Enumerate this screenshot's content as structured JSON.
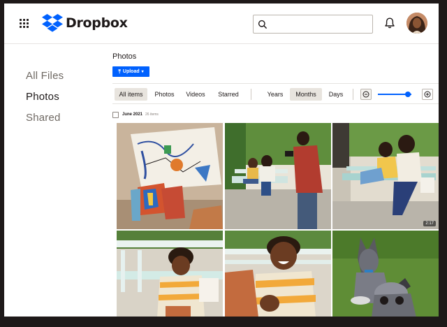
{
  "app": {
    "logo_text": "Dropbox"
  },
  "search": {
    "value": "",
    "placeholder": ""
  },
  "sidebar": {
    "items": [
      {
        "label": "All Files",
        "active": false
      },
      {
        "label": "Photos",
        "active": true
      },
      {
        "label": "Shared",
        "active": false
      }
    ]
  },
  "main": {
    "title": "Photos",
    "upload_label": "Upload"
  },
  "toolbar": {
    "filters": [
      "All items",
      "Photos",
      "Videos",
      "Starred"
    ],
    "selected_filter": "All items",
    "views": [
      "Years",
      "Months",
      "Days"
    ],
    "selected_view": "Months",
    "zoom_level": 0.9
  },
  "gallery": {
    "date_label": "June 2021",
    "count_label": "26 items",
    "photos": [
      {
        "subject": "abstract collage artwork",
        "duration": ""
      },
      {
        "subject": "man photographing family on porch swing",
        "duration": ""
      },
      {
        "subject": "mother and son on porch swing",
        "duration": "2:17"
      },
      {
        "subject": "boy on bench with pillow",
        "duration": ""
      },
      {
        "subject": "smiling boy on bench",
        "duration": ""
      },
      {
        "subject": "two dogs on grass",
        "duration": ""
      }
    ]
  },
  "colors": {
    "accent": "#0061fe",
    "text": "#1e1919",
    "muted": "#6f6963",
    "selected_bg": "#e8e4de"
  }
}
